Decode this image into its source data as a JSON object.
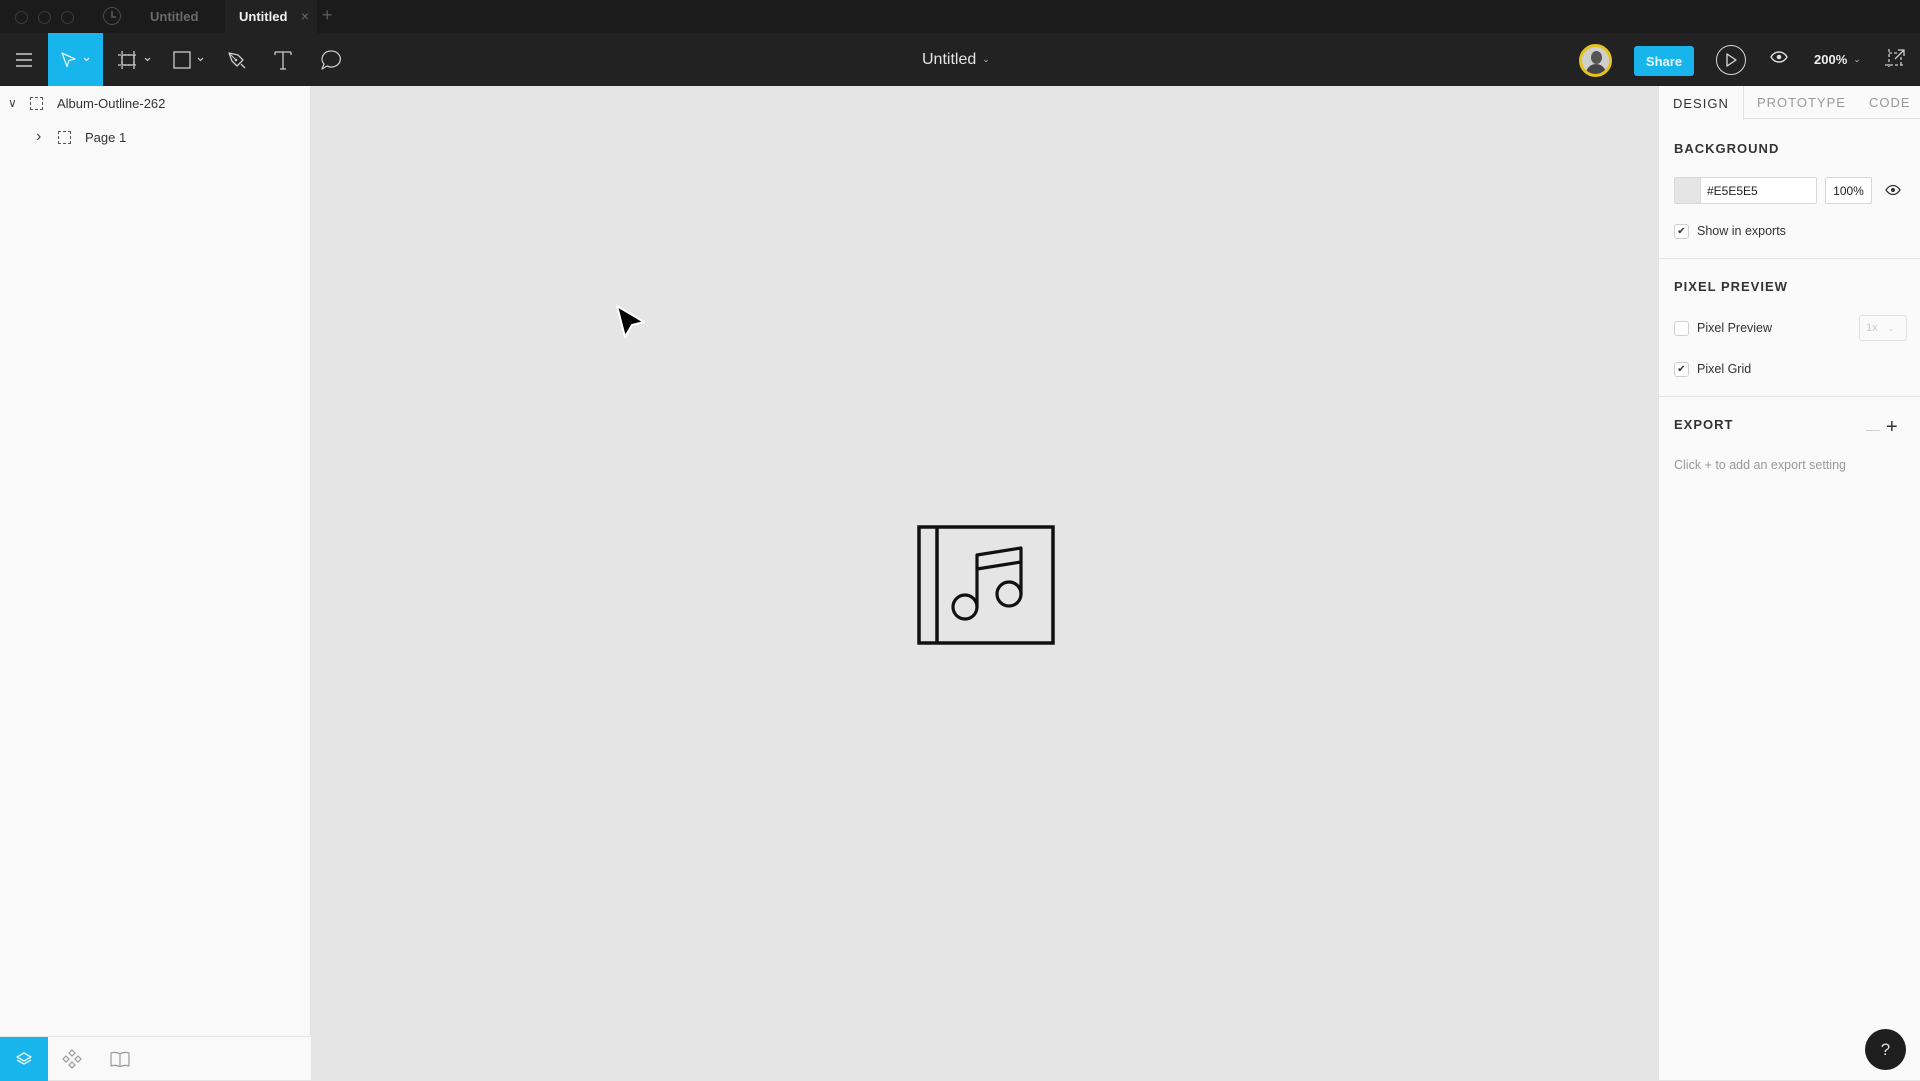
{
  "window": {
    "tabs": [
      {
        "label": "Untitled",
        "active": false
      },
      {
        "label": "Untitled",
        "active": true
      }
    ],
    "close_tab_glyph": "×",
    "new_tab_glyph": "+"
  },
  "toolbar": {
    "tools": [
      {
        "name": "menu-icon"
      },
      {
        "name": "move-tool-icon",
        "active": true
      },
      {
        "name": "frame-tool-icon"
      },
      {
        "name": "rectangle-tool-icon"
      },
      {
        "name": "pen-tool-icon"
      },
      {
        "name": "text-tool-icon"
      },
      {
        "name": "comment-tool-icon"
      }
    ],
    "document_title": "Untitled",
    "chevron": "⌄",
    "share_label": "Share",
    "zoom_level": "200%",
    "accent_color": "#18B5EC"
  },
  "layers": {
    "items": [
      {
        "label": "Album-Outline-262",
        "expanded": true,
        "chevron": "∨"
      },
      {
        "label": "Page 1",
        "expanded": false,
        "chevron": "›"
      }
    ]
  },
  "bottom_tabs": [
    {
      "name": "layers-icon",
      "active": true
    },
    {
      "name": "components-icon",
      "active": false
    },
    {
      "name": "library-icon",
      "active": false
    }
  ],
  "canvas": {
    "background": "#E5E5E5",
    "object": "album-outline-icon"
  },
  "right_panel": {
    "tabs": [
      {
        "label": "DESIGN",
        "active": true
      },
      {
        "label": "PROTOTYPE",
        "active": false
      },
      {
        "label": "CODE",
        "active": false
      }
    ],
    "background": {
      "title": "BACKGROUND",
      "color_value": "#E5E5E5",
      "opacity": "100%",
      "show_in_exports_label": "Show in exports",
      "show_in_exports": true
    },
    "pixel_preview": {
      "title": "PIXEL PREVIEW",
      "pixel_preview_label": "Pixel Preview",
      "pixel_preview_checked": false,
      "scale_value": "1x",
      "pixel_grid_label": "Pixel Grid",
      "pixel_grid_checked": true
    },
    "export": {
      "title": "EXPORT",
      "minus_glyph": "—",
      "plus_glyph": "+",
      "hint": "Click + to add an export setting"
    },
    "check_glyph": "✔"
  },
  "help_label": "?"
}
